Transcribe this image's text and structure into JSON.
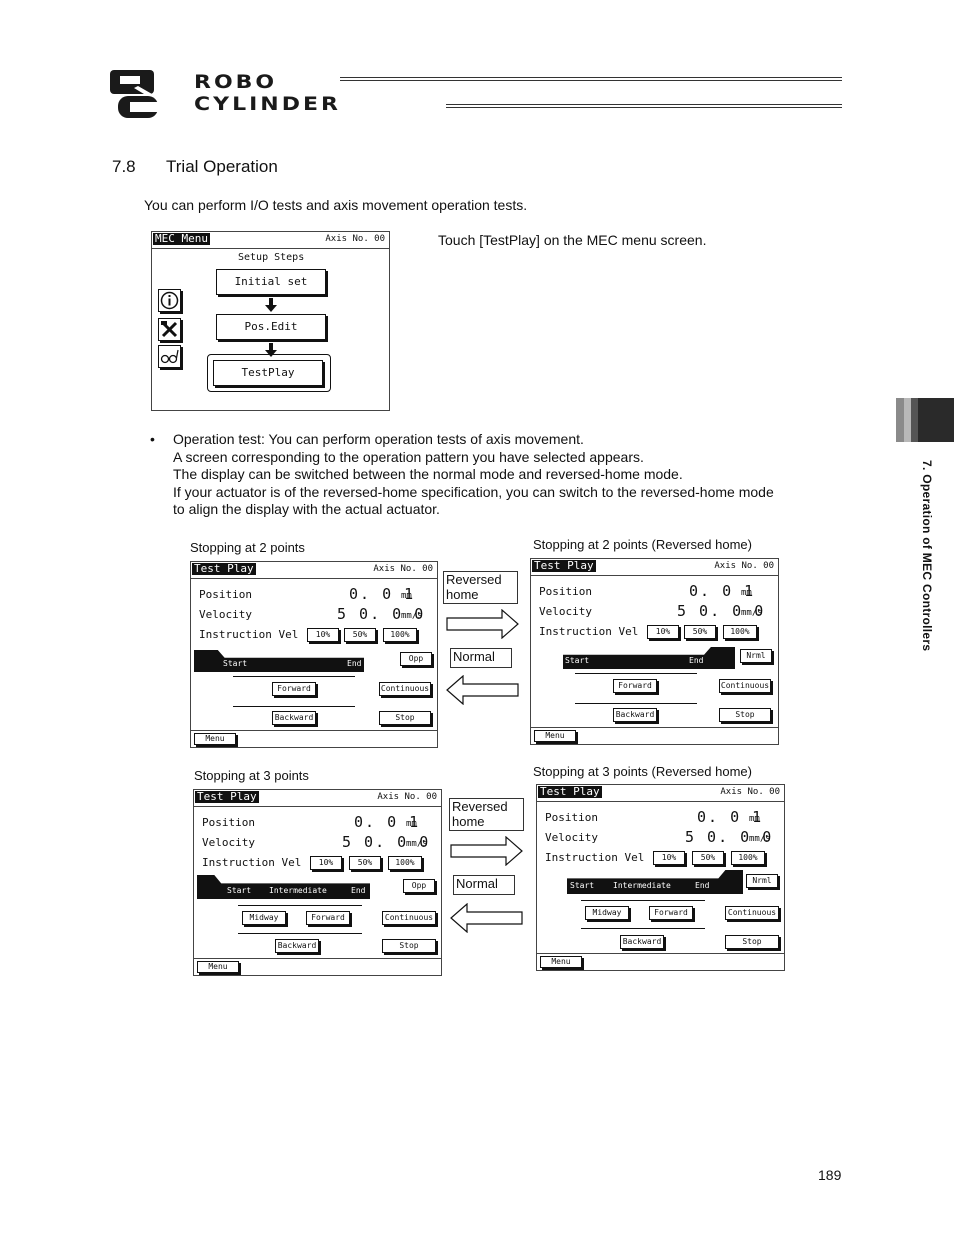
{
  "header": {
    "logo_text_line1": "ROBO",
    "logo_text_line2": "CYLINDER",
    "logo_mark": "RC"
  },
  "section": {
    "number": "7.8",
    "title": "Trial Operation"
  },
  "intro": "You can perform I/O tests and axis movement operation tests.",
  "mec_menu": {
    "title": "MEC Menu",
    "axis": "Axis No. 00",
    "setup_steps": "Setup Steps",
    "buttons": [
      "Initial set",
      "Pos.Edit",
      "TestPlay"
    ],
    "side_icons": [
      "info-icon",
      "tools-icon",
      "glasses-icon"
    ]
  },
  "touch_text": "Touch [TestPlay] on the MEC menu screen.",
  "bullet": {
    "marker": "•",
    "lines": [
      "Operation test: You can perform operation tests of axis movement.",
      "A screen corresponding to the operation pattern you have selected appears.",
      "The display can be switched between the normal mode and reversed-home mode.",
      "If your actuator is of the reversed-home specification, you can switch to the reversed-home mode",
      "to align the display with the actual actuator."
    ]
  },
  "captions": {
    "two_points": "Stopping at 2 points",
    "two_points_rev": "Stopping at 2 points (Reversed home)",
    "three_points": "Stopping at 3 points",
    "three_points_rev": "Stopping at 3 points (Reversed home)"
  },
  "mode_labels": {
    "reversed_home": "Reversed home",
    "normal": "Normal"
  },
  "test_play": {
    "title": "Test Play",
    "axis": "Axis No. 00",
    "position_label": "Position",
    "position_value": "0. 0 1",
    "position_unit": "mm",
    "velocity_label": "Velocity",
    "velocity_value": "5 0. 0 0",
    "velocity_unit": "mm/s",
    "instr_label": "Instruction Vel",
    "speeds": [
      "10%",
      "50%",
      "100%"
    ],
    "opp": "Opp",
    "nrml": "Nrml",
    "start": "Start",
    "intermediate": "Intermediate",
    "end": "End",
    "forward": "Forward",
    "backward": "Backward",
    "midway": "Midway",
    "continuous": "Continuous",
    "stop": "Stop",
    "menu": "Menu"
  },
  "side_tab": "7. Operation of MEC Controllers",
  "page_number": "189"
}
